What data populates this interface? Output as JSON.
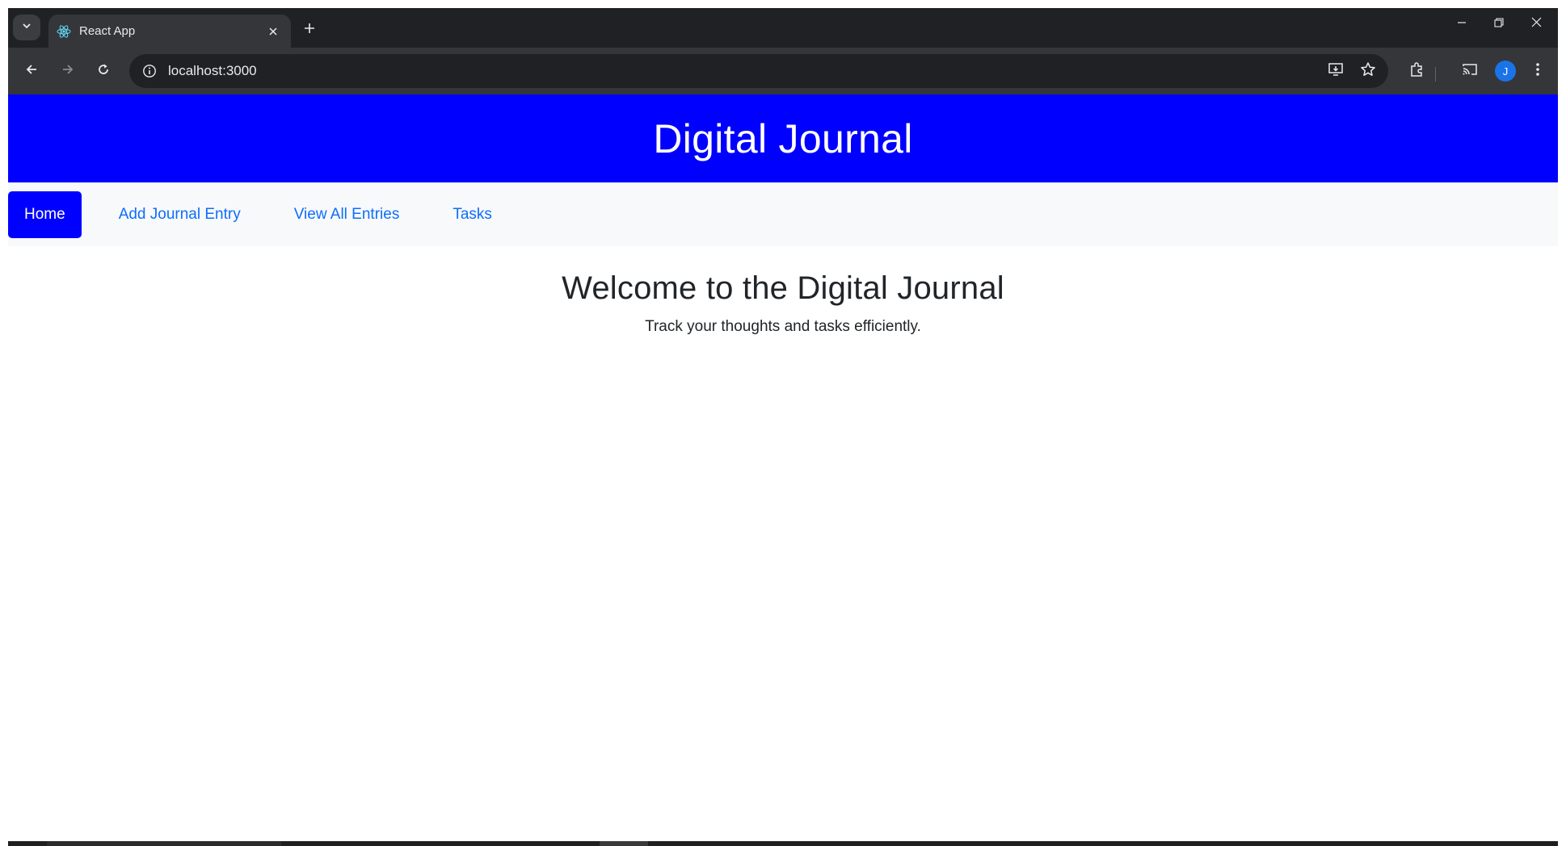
{
  "browser": {
    "tab_title": "React App",
    "url": "localhost:3000",
    "profile_initial": "J"
  },
  "app": {
    "title": "Digital Journal",
    "nav": [
      {
        "label": "Home",
        "active": true
      },
      {
        "label": "Add Journal Entry",
        "active": false
      },
      {
        "label": "View All Entries",
        "active": false
      },
      {
        "label": "Tasks",
        "active": false
      }
    ],
    "welcome": {
      "heading": "Welcome to the Digital Journal",
      "subtitle": "Track your thoughts and tasks efficiently."
    }
  },
  "colors": {
    "header_bg": "#0000ff",
    "nav_bg": "#f8f9fa",
    "link": "#0d6efd",
    "chrome_dark": "#202124",
    "chrome_toolbar": "#35363a"
  }
}
